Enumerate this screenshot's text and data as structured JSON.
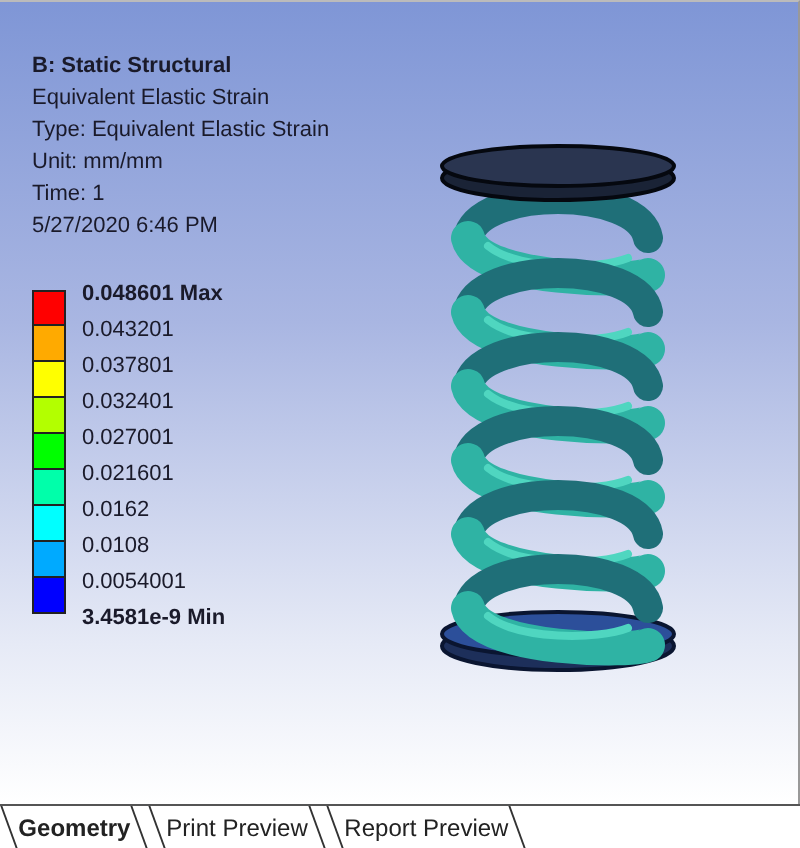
{
  "header": {
    "title": "B: Static Structural",
    "lines": [
      "Equivalent Elastic Strain",
      "Type: Equivalent Elastic Strain",
      "Unit: mm/mm",
      "Time: 1",
      "5/27/2020 6:46 PM"
    ]
  },
  "legend": {
    "labels": [
      {
        "text": "0.048601 Max",
        "kind": "extreme"
      },
      {
        "text": "0.043201",
        "kind": "value"
      },
      {
        "text": "0.037801",
        "kind": "value"
      },
      {
        "text": "0.032401",
        "kind": "value"
      },
      {
        "text": "0.027001",
        "kind": "value"
      },
      {
        "text": "0.021601",
        "kind": "value"
      },
      {
        "text": "0.0162",
        "kind": "value"
      },
      {
        "text": "0.0108",
        "kind": "value"
      },
      {
        "text": "0.0054001",
        "kind": "value"
      },
      {
        "text": "3.4581e-9 Min",
        "kind": "extreme"
      }
    ],
    "bands": [
      {
        "color": "#ff0000"
      },
      {
        "color": "#ffaa00"
      },
      {
        "color": "#ffff00"
      },
      {
        "color": "#b3ff00"
      },
      {
        "color": "#00ff00"
      },
      {
        "color": "#00ffaa"
      },
      {
        "color": "#00ffff"
      },
      {
        "color": "#00aaff"
      },
      {
        "color": "#0000ff"
      }
    ]
  },
  "tabs": [
    {
      "label": "Geometry",
      "selected": true
    },
    {
      "label": "Print Preview",
      "selected": false
    },
    {
      "label": "Report Preview",
      "selected": false
    }
  ]
}
